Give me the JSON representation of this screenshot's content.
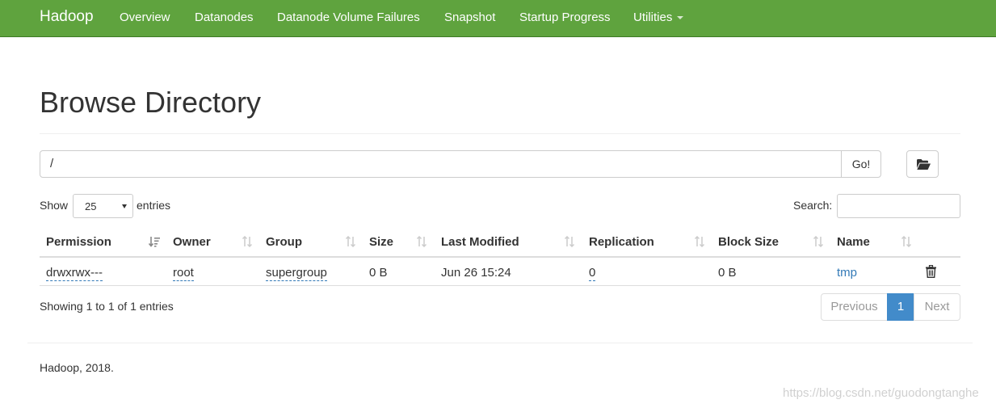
{
  "navbar": {
    "brand": "Hadoop",
    "items": [
      "Overview",
      "Datanodes",
      "Datanode Volume Failures",
      "Snapshot",
      "Startup Progress",
      "Utilities"
    ],
    "color": "#5fa33e"
  },
  "page": {
    "title": "Browse Directory"
  },
  "path_bar": {
    "value": "/",
    "go_label": "Go!",
    "folder_icon": "folder-open-icon"
  },
  "controls": {
    "show_label": "Show",
    "entries_value": "25",
    "entries_label": "entries",
    "search_label": "Search:",
    "search_value": ""
  },
  "table": {
    "columns": [
      "Permission",
      "Owner",
      "Group",
      "Size",
      "Last Modified",
      "Replication",
      "Block Size",
      "Name"
    ],
    "rows": [
      {
        "permission": "drwxrwx---",
        "owner": "root",
        "group": "supergroup",
        "size": "0 B",
        "last_modified": "Jun 26 15:24",
        "replication": "0",
        "block_size": "0 B",
        "name": "tmp"
      }
    ],
    "delete_icon": "trash-icon"
  },
  "info": "Showing 1 to 1 of 1 entries",
  "pagination": {
    "previous": "Previous",
    "current": "1",
    "next": "Next",
    "active_color": "#428bca"
  },
  "footer": "Hadoop, 2018.",
  "watermark": "https://blog.csdn.net/guodongtanghe"
}
